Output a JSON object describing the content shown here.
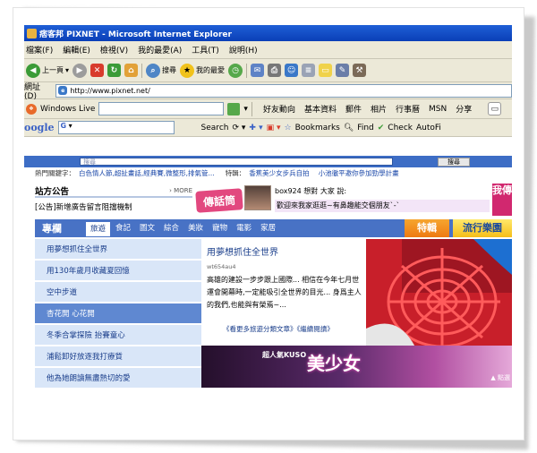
{
  "window": {
    "title": "痞客邦 PIXNET - Microsoft Internet Explorer"
  },
  "menu": [
    "檔案(F)",
    "編輯(E)",
    "檢視(V)",
    "我的最愛(A)",
    "工具(T)",
    "說明(H)"
  ],
  "toolbar": {
    "back": "上一頁",
    "search": "搜尋",
    "favorites": "我的最愛"
  },
  "address": {
    "label": "網址(D)",
    "url": "http://www.pixnet.net/"
  },
  "livebar": {
    "brand": "Windows Live",
    "links": [
      "好友動向",
      "基本資料",
      "郵件",
      "相片",
      "行事曆",
      "MSN",
      "分享"
    ]
  },
  "googlebar": {
    "logo": "oogle",
    "field": "G",
    "search": "Search",
    "bookmarks": "Bookmarks",
    "find": "Find",
    "check": "Check",
    "autofill": "AutoFi"
  },
  "page": {
    "search_placeholder": "搜尋",
    "search_button": "搜尋",
    "hotwords_label": "熱門關鍵字：",
    "hotwords": "白色情人節,超扯畫話,經典賽,微整形,排氣管...",
    "hotwords_extra": "特輯：",
    "hot_link1": "香蕉美少女步兵自拍",
    "hot_link2": "小池徹平邀你參加勁學計畫",
    "notice": {
      "title": "站方公告",
      "more": "MORE",
      "body": "[公告]新增廣告留言阻擋機制"
    },
    "bubble": {
      "title": "傳話筒",
      "user_line": "box924 想對 大家 說:",
      "message": "歡迎來我家逛逛~有鼻趣能交個朋友`-`",
      "side": "我傳"
    },
    "tabs": {
      "section": "專欄",
      "items": [
        "旅遊",
        "食記",
        "圖文",
        "綜合",
        "美妝",
        "寵物",
        "電影",
        "家居"
      ],
      "featured": "特輯",
      "popular": "流行樂園"
    },
    "list": [
      "用夢想抓住全世界",
      "用130年歲月收藏夏回憶",
      "空中步道",
      "杏花開 心花開",
      "冬季合掌探險 抬賽童心",
      "浦鬆卸好放逐我打療質",
      "他為她朗讀無盡熱切的愛"
    ],
    "article": {
      "title": "用夢想抓住全世界",
      "author": "wt654au4",
      "body": "高雄的建設一步步跟上國際... 相信在今年七月世運會開幕時,一定能吸引全世界的目光... 身爲主人的我們,也能與有榮焉~...",
      "links": "《看更多旅遊分類文章》《繼續閱讀》"
    },
    "kuso": {
      "small": "超人氣KUSO",
      "big": "美少女",
      "corner": "▲ 點選"
    }
  }
}
